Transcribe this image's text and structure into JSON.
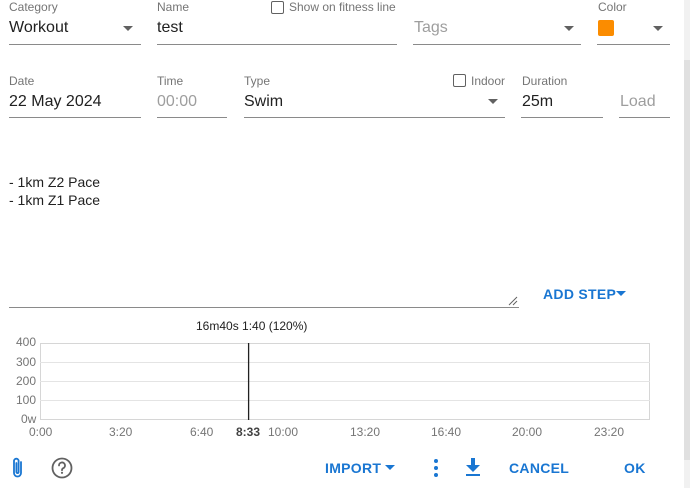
{
  "form": {
    "category": {
      "label": "Category",
      "value": "Workout"
    },
    "name": {
      "label": "Name",
      "value": "test"
    },
    "fitness_line": {
      "label": "Show on fitness line",
      "checked": false
    },
    "tags": {
      "placeholder": "Tags"
    },
    "color": {
      "label": "Color",
      "value": "#fb8c00"
    },
    "date": {
      "label": "Date",
      "value": "22 May 2024"
    },
    "time": {
      "label": "Time",
      "placeholder": "00:00"
    },
    "type": {
      "label": "Type",
      "value": "Swim"
    },
    "indoor": {
      "label": "Indoor",
      "checked": false
    },
    "duration": {
      "label": "Duration",
      "value": "25m"
    },
    "load": {
      "placeholder": "Load"
    }
  },
  "description": {
    "lines": [
      "- 1km Z2 Pace",
      "- 1km Z1 Pace"
    ]
  },
  "add_step": {
    "label": "ADD STEP"
  },
  "chart": {
    "cursor_label": "16m40s 1:40 (120%)",
    "cursor_time_label": "8:33",
    "y_ticks": [
      "400",
      "300",
      "200",
      "100",
      "0w"
    ],
    "x_ticks": [
      "0:00",
      "3:20",
      "6:40",
      "10:00",
      "13:20",
      "16:40",
      "20:00",
      "23:20"
    ]
  },
  "chart_data": {
    "type": "line",
    "x_unit": "time",
    "ylim": [
      0,
      400
    ],
    "xlim_seconds": [
      0,
      1500
    ],
    "cursor_seconds": 513,
    "series": []
  },
  "footer": {
    "import_label": "IMPORT",
    "cancel_label": "CANCEL",
    "ok_label": "OK"
  },
  "colors": {
    "accent": "#1976d2",
    "workout_color": "#fb8c00"
  }
}
